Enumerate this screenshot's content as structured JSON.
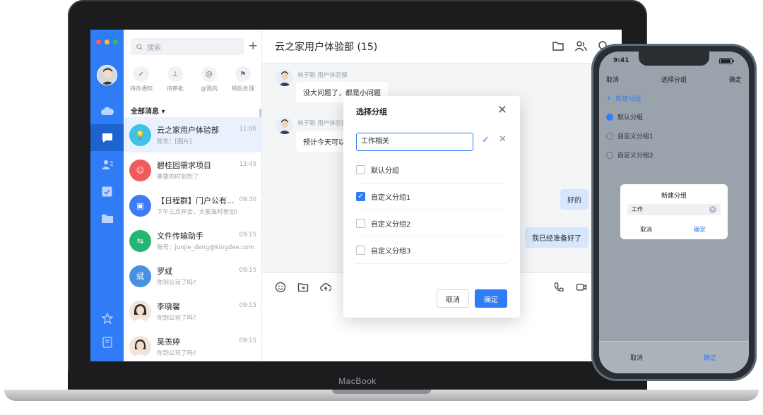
{
  "device_brand": "MacBook",
  "app": {
    "search_placeholder": "搜索",
    "shortcuts": [
      "待办通知",
      "待审批",
      "@我的",
      "稍后处理"
    ],
    "section_label": "全部消息 ▾",
    "conversations": [
      {
        "title": "云之家用户体验部",
        "subtitle": "陈东：[图片]",
        "time": "11:06",
        "avatar_color": "#3fc1e8",
        "avatar_text": "💡"
      },
      {
        "title": "碧桂园需求项目",
        "subtitle": "重要的时刻到了",
        "time": "13:45",
        "avatar_color": "#ef5b5b",
        "avatar_text": "☺"
      },
      {
        "title": "【日程群】门户公有...",
        "subtitle": "下午三点开会，大家准时参加!",
        "time": "09:30",
        "avatar_color": "#3d7cf5",
        "avatar_text": "▣"
      },
      {
        "title": "文件传输助手",
        "subtitle": "账号：junjie_deng@kingdee.com",
        "time": "09:15",
        "avatar_color": "#22b573",
        "avatar_text": "⇆"
      },
      {
        "title": "罗斌",
        "subtitle": "你到公司了吗?",
        "time": "09:15",
        "avatar_color": "#4a90e2",
        "avatar_text": "斌"
      },
      {
        "title": "李晓馨",
        "subtitle": "你到公司了吗?",
        "time": "09:15",
        "avatar_color": "#e9d9cc",
        "avatar_text": ""
      },
      {
        "title": "吴羡婷",
        "subtitle": "你到公司了吗?",
        "time": "09:15",
        "avatar_color": "#e9d9cc",
        "avatar_text": ""
      }
    ],
    "chat": {
      "title": "云之家用户体验部 (15)",
      "messages": [
        {
          "sender": "林子聪 用户体验部",
          "text": "没大问题了，都是小问题"
        },
        {
          "sender": "林子聪 用户体验部",
          "text": "预计今天可以"
        }
      ],
      "my_messages": [
        "好的",
        "我已经准备好了"
      ]
    },
    "dialog": {
      "title": "选择分组",
      "input_value": "工作相关",
      "options": [
        {
          "label": "默认分组",
          "checked": false
        },
        {
          "label": "自定义分组1",
          "checked": true
        },
        {
          "label": "自定义分组2",
          "checked": false
        },
        {
          "label": "自定义分组3",
          "checked": false
        }
      ],
      "cancel_label": "取消",
      "ok_label": "确定"
    }
  },
  "phone": {
    "time": "9:41",
    "nav_cancel": "取消",
    "nav_title": "选择分组",
    "nav_ok": "确定",
    "new_group": "新建分组",
    "options": [
      {
        "label": "默认分组",
        "checked": true
      },
      {
        "label": "自定义分组1",
        "checked": false
      },
      {
        "label": "自定义分组2",
        "checked": false
      }
    ],
    "dialog_title": "新建分组",
    "dialog_input": "工作",
    "dialog_cancel": "取消",
    "dialog_ok": "确定",
    "bottom_cancel": "取消",
    "bottom_ok": "确定"
  },
  "colors": {
    "accent": "#2f7cf6",
    "rail": "#2f7cf6"
  }
}
